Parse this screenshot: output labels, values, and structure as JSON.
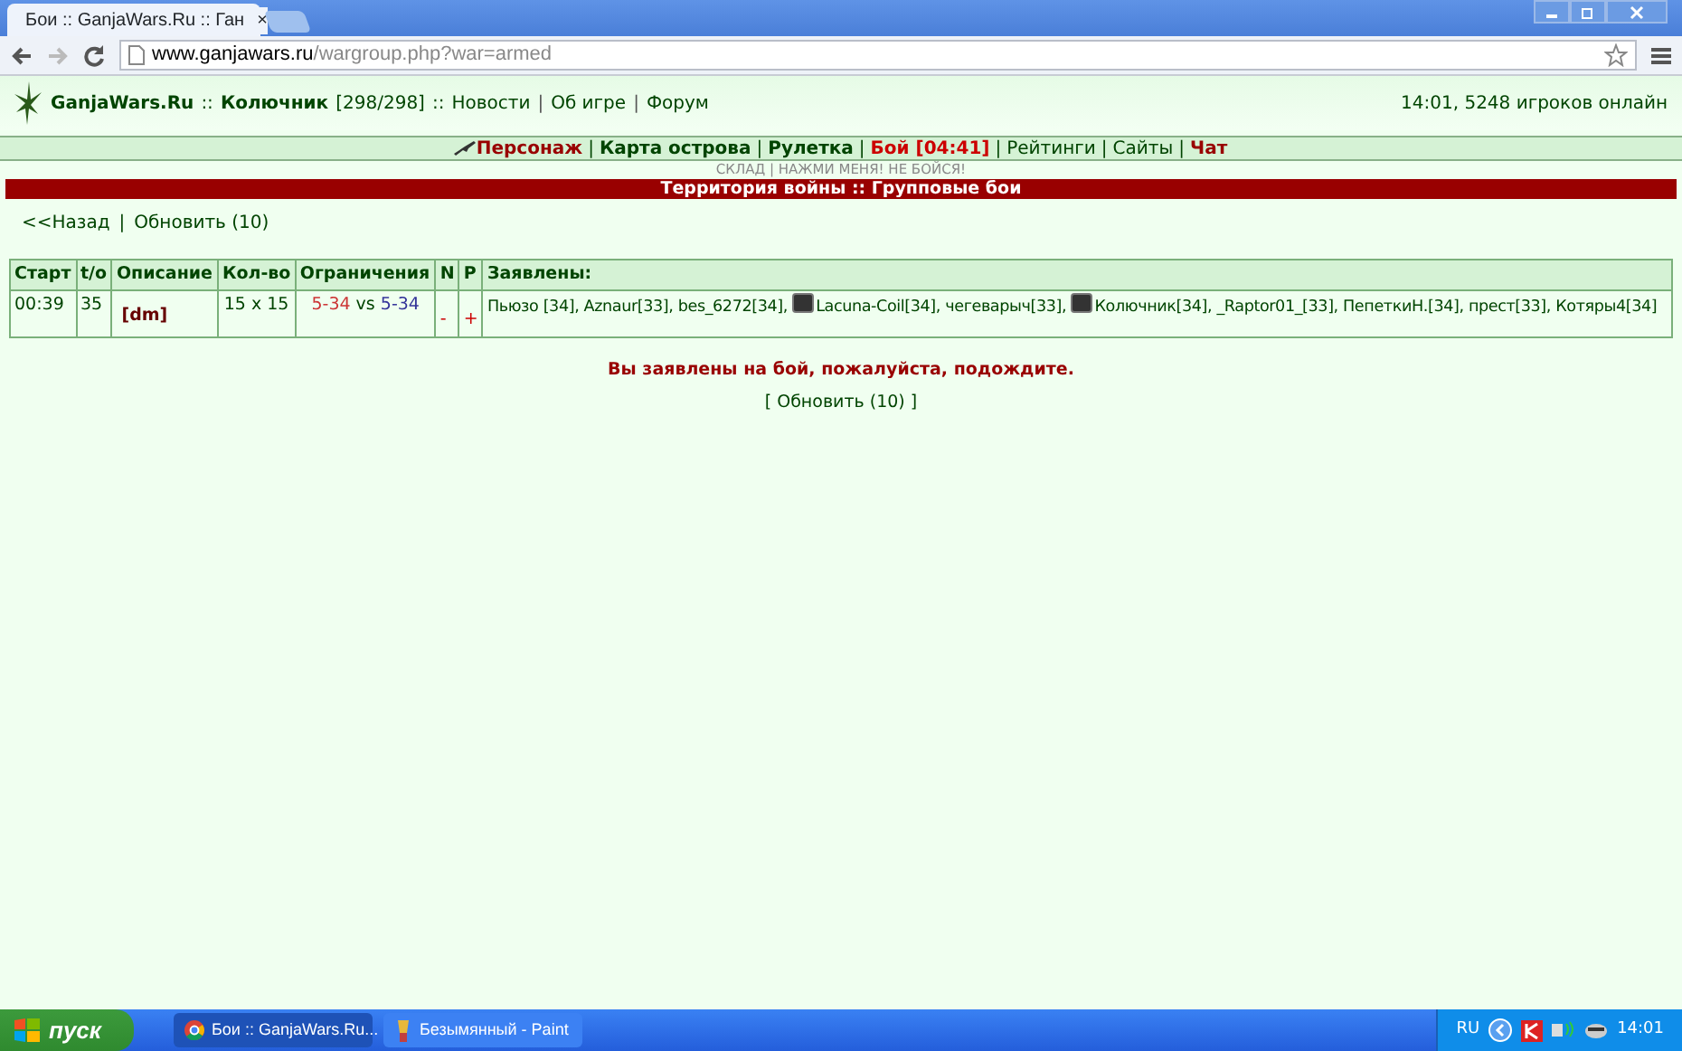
{
  "browser": {
    "tab_title": "Бои :: GanjaWars.Ru :: Ган",
    "close": "×",
    "url_host": "www.ganjawars.ru",
    "url_path": "/wargroup.php?war=armed"
  },
  "header": {
    "site": "GanjaWars.Ru",
    "sep1": "::",
    "user": "Колючник",
    "hp": "[298/298]",
    "sep2": "::",
    "links": [
      {
        "kind": "link",
        "text": "Новости"
      },
      {
        "kind": "sep",
        "text": "|"
      },
      {
        "kind": "link",
        "text": "Об игре"
      },
      {
        "kind": "sep",
        "text": "|"
      },
      {
        "kind": "link",
        "text": "Форум"
      }
    ],
    "online": "14:01, 5248 игроков онлайн"
  },
  "nav": [
    {
      "kind": "char",
      "text": "Персонаж"
    },
    {
      "kind": "sep",
      "text": "|"
    },
    {
      "kind": "bold",
      "text": "Карта острова"
    },
    {
      "kind": "sep",
      "text": "|"
    },
    {
      "kind": "bold",
      "text": "Рулетка"
    },
    {
      "kind": "sep",
      "text": "|"
    },
    {
      "kind": "alert",
      "text": "Бой [04:41]"
    },
    {
      "kind": "sep",
      "text": "|"
    },
    {
      "kind": "plain",
      "text": "Рейтинги"
    },
    {
      "kind": "sep",
      "text": "|"
    },
    {
      "kind": "plain",
      "text": "Сайты"
    },
    {
      "kind": "sep",
      "text": "|"
    },
    {
      "kind": "char",
      "text": "Чат"
    }
  ],
  "subline": "СКЛАД | НАЖМИ МЕНЯ! НЕ БОЙСЯ!",
  "banner": "Территория войны :: Групповые бои",
  "actions": [
    {
      "kind": "link",
      "text": "<<Назад"
    },
    {
      "kind": "sep",
      "text": "|"
    },
    {
      "kind": "link",
      "text": "Обновить (10)"
    }
  ],
  "table": {
    "columns": [
      "Старт",
      "t/o",
      "Описание",
      "Кол-во",
      "Ограничения",
      "N",
      "P",
      "Заявлены:"
    ],
    "rows": [
      {
        "start": "00:39",
        "timeout": "35",
        "description": "[dm]",
        "count": "15 x 15",
        "limit_a": "5-34",
        "vs": "vs",
        "limit_b": "5-34",
        "n": "-",
        "p": "+",
        "applicants": [
          {
            "name": "Пьюзо [34],",
            "avatar": false
          },
          {
            "name": "Aznaur[33],",
            "avatar": false
          },
          {
            "name": "bes_6272[34],",
            "avatar": false
          },
          {
            "name": "Lacuna-Coil[34],",
            "avatar": true
          },
          {
            "name": "чегеварыч[33],",
            "avatar": false
          },
          {
            "name": "Колючник[34],",
            "avatar": true
          },
          {
            "name": "_Raptor01_[33],",
            "avatar": false
          },
          {
            "name": "ПепеткиН.[34],",
            "avatar": false
          },
          {
            "name": "прест[33],",
            "avatar": false
          },
          {
            "name": "Котяры4[34]",
            "avatar": false
          }
        ]
      }
    ]
  },
  "message": "Вы заявлены на бой, пожалуйста, подождите.",
  "refresh": "[ Обновить (10) ]",
  "taskbar": {
    "start": "пуск",
    "tasks": [
      {
        "kind": "chrome",
        "text": "Бои :: GanjaWars.Ru...",
        "selected": true
      },
      {
        "kind": "paint",
        "text": "Безымянный - Paint",
        "selected": false
      }
    ],
    "lang": "RU",
    "clock": "14:01"
  }
}
